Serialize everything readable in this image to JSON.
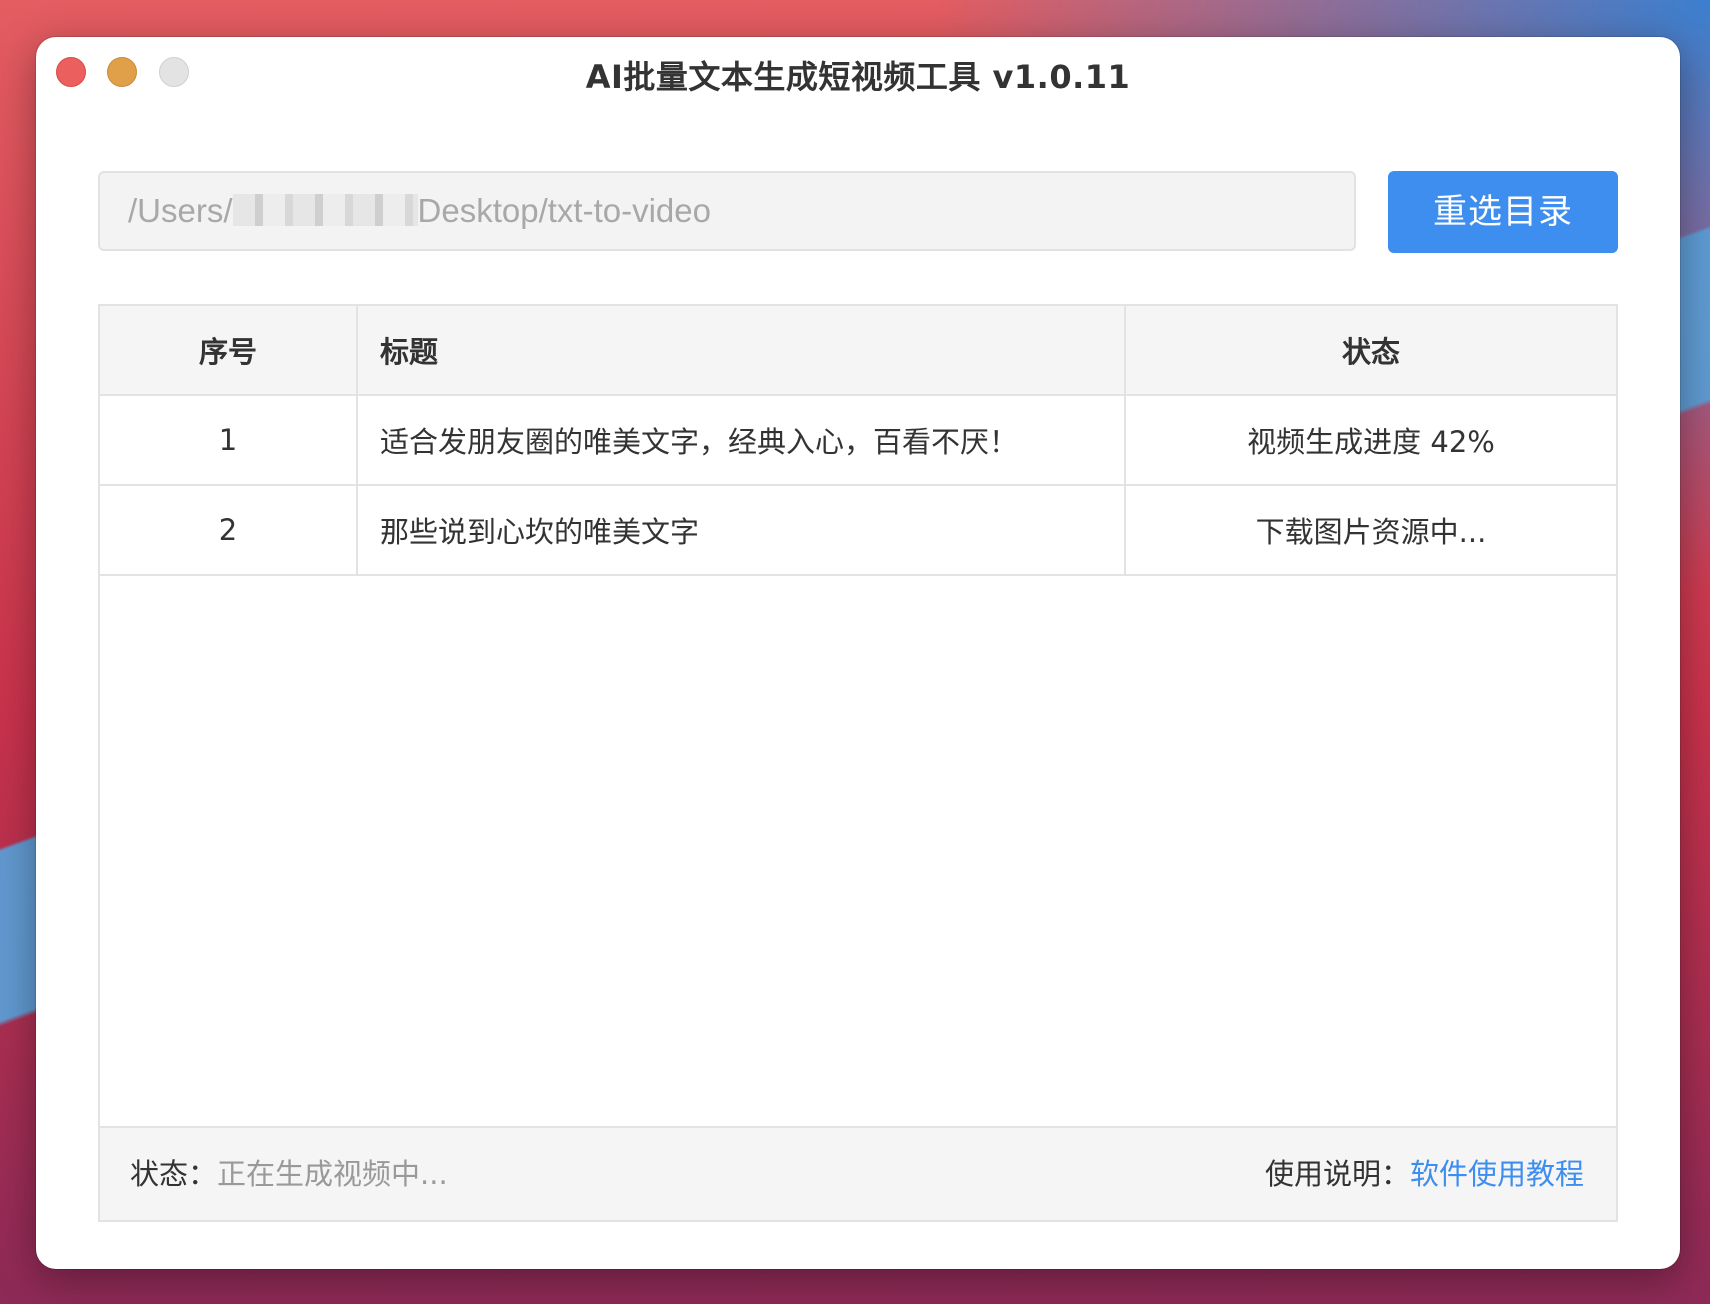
{
  "window": {
    "title": "AI批量文本生成短视频工具 v1.0.11"
  },
  "toolbar": {
    "path_prefix": "/Users/",
    "path_suffix": "Desktop/txt-to-video",
    "reselect_label": "重选目录"
  },
  "table": {
    "columns": [
      "序号",
      "标题",
      "状态"
    ],
    "rows": [
      {
        "no": "1",
        "title": "适合发朋友圈的唯美文字，经典入心，百看不厌！",
        "status": "视频生成进度 42%"
      },
      {
        "no": "2",
        "title": "那些说到心坎的唯美文字",
        "status": "下载图片资源中..."
      }
    ]
  },
  "statusbar": {
    "status_label": "状态：",
    "status_value": "正在生成视频中...",
    "help_label": "使用说明：",
    "help_link": "软件使用教程"
  }
}
